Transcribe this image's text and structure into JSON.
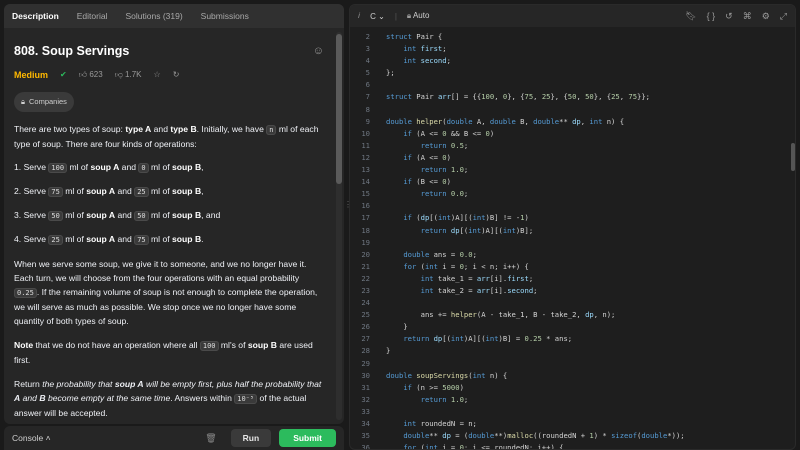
{
  "tabs": [
    "Description",
    "Editorial",
    "Solutions (319)",
    "Submissions"
  ],
  "problem": {
    "title": "808. Soup Servings",
    "difficulty": "Medium",
    "likes": "623",
    "dislikes": "1.7K",
    "companies_label": "Companies",
    "intro_1": "There are two types of soup: ",
    "soupA": "type A",
    "and_word": " and ",
    "soupB": "type B",
    "intro_2": ". Initially, we have ",
    "n": "n",
    "intro_3": " ml of each type of soup. There are four kinds of operations:",
    "ops": [
      {
        "num": "1.",
        "a": "100",
        "b": "0"
      },
      {
        "num": "2.",
        "a": "75",
        "b": "25"
      },
      {
        "num": "3.",
        "a": "50",
        "b": "50",
        "suffix": ", and"
      },
      {
        "num": "4.",
        "a": "25",
        "b": "75"
      }
    ],
    "op_serve": "Serve ",
    "op_ml_of": " ml of ",
    "op_soupA": "soup A",
    "op_and": " and ",
    "op_soupB": "soup B",
    "para2_1": "When we serve some soup, we give it to someone, and we no longer have it. Each turn, we will choose from the four operations with an equal probability ",
    "para2_prob": "0.25",
    "para2_2": ". If the remaining volume of soup is not enough to complete the operation, we will serve as much as possible. We stop once we no longer have some quantity of both types of soup.",
    "note_bold": "Note",
    "note_1": " that we do not have an operation where all ",
    "note_code": "100",
    "note_2": " ml's of ",
    "note_soupB": "soup B",
    "note_3": " are used first.",
    "ret_1": "Return ",
    "ret_i1": "the probability that ",
    "ret_soupA": "soup A",
    "ret_i2": " will be empty first, plus half the probability that ",
    "ret_A": "A",
    "ret_and": " and ",
    "ret_B": "B",
    "ret_i3": " become empty at the same time",
    "ret_2": ". Answers within ",
    "ret_code": "10⁻⁵",
    "ret_3": " of the actual answer will be accepted."
  },
  "console": {
    "label": "Console",
    "run": "Run",
    "submit": "Submit"
  },
  "editor": {
    "language": "C",
    "mode": "Auto",
    "lines": [
      {
        "n": "2",
        "t": "struct Pair {"
      },
      {
        "n": "3",
        "t": "    int first;"
      },
      {
        "n": "4",
        "t": "    int second;"
      },
      {
        "n": "5",
        "t": "};"
      },
      {
        "n": "6",
        "t": ""
      },
      {
        "n": "7",
        "t": "struct Pair arr[] = {{100, 0}, {75, 25}, {50, 50}, {25, 75}};"
      },
      {
        "n": "8",
        "t": ""
      },
      {
        "n": "9",
        "t": "double helper(double A, double B, double** dp, int n) {"
      },
      {
        "n": "10",
        "t": "    if (A <= 0 && B <= 0)"
      },
      {
        "n": "11",
        "t": "        return 0.5;"
      },
      {
        "n": "12",
        "t": "    if (A <= 0)"
      },
      {
        "n": "13",
        "t": "        return 1.0;"
      },
      {
        "n": "14",
        "t": "    if (B <= 0)"
      },
      {
        "n": "15",
        "t": "        return 0.0;"
      },
      {
        "n": "16",
        "t": ""
      },
      {
        "n": "17",
        "t": "    if (dp[(int)A][(int)B] != -1)"
      },
      {
        "n": "18",
        "t": "        return dp[(int)A][(int)B];"
      },
      {
        "n": "19",
        "t": ""
      },
      {
        "n": "20",
        "t": "    double ans = 0.0;"
      },
      {
        "n": "21",
        "t": "    for (int i = 0; i < n; i++) {"
      },
      {
        "n": "22",
        "t": "        int take_1 = arr[i].first;"
      },
      {
        "n": "23",
        "t": "        int take_2 = arr[i].second;"
      },
      {
        "n": "24",
        "t": ""
      },
      {
        "n": "25",
        "t": "        ans += helper(A - take_1, B - take_2, dp, n);"
      },
      {
        "n": "26",
        "t": "    }"
      },
      {
        "n": "27",
        "t": "    return dp[(int)A][(int)B] = 0.25 * ans;"
      },
      {
        "n": "28",
        "t": "}"
      },
      {
        "n": "29",
        "t": ""
      },
      {
        "n": "30",
        "t": "double soupServings(int n) {"
      },
      {
        "n": "31",
        "t": "    if (n >= 5000)"
      },
      {
        "n": "32",
        "t": "        return 1.0;"
      },
      {
        "n": "33",
        "t": ""
      },
      {
        "n": "34",
        "t": "    int roundedN = n;"
      },
      {
        "n": "35",
        "t": "    double** dp = (double**)malloc((roundedN + 1) * sizeof(double*));"
      },
      {
        "n": "36",
        "t": "    for (int i = 0; i <= roundedN; i++) {"
      }
    ]
  }
}
